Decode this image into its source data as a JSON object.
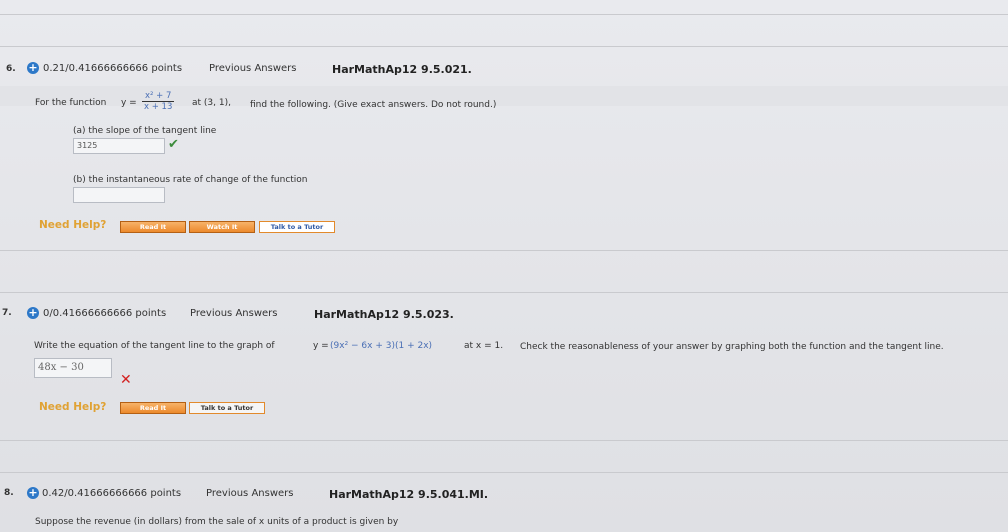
{
  "q6": {
    "number": "6.",
    "points": "0.21/0.41666666666 points",
    "previous": "Previous Answers",
    "code": "HarMathAp12 9.5.021.",
    "prompt_prefix": "For the function",
    "y_eq": "y =",
    "frac_num": "x² + 7",
    "frac_den": "x + 13",
    "point": "at (3, 1),",
    "prompt_suffix": "find the following. (Give exact answers. Do not round.)",
    "part_a": "(a) the slope of the tangent line",
    "answer_a": "3125",
    "part_b": "(b) the instantaneous rate of change of the function",
    "answer_b": "",
    "need_help": "Need Help?",
    "btn_read": "Read It",
    "btn_watch": "Watch It",
    "btn_tutor": "Talk to a Tutor"
  },
  "q7": {
    "number": "7.",
    "points": "0/0.41666666666 points",
    "previous": "Previous Answers",
    "code": "HarMathAp12 9.5.023.",
    "prompt": "Write the equation of the tangent line to the graph of",
    "y_eq": "y = ",
    "expr": "(9x² − 6x + 3)(1 + 2x)",
    "at": "at x = 1.",
    "prompt_suffix": "Check the reasonableness of your answer by graphing both the function and the tangent line.",
    "answer": "48x − 30",
    "need_help": "Need Help?",
    "btn_read": "Read It",
    "btn_tutor": "Talk to a Tutor"
  },
  "q8": {
    "number": "8.",
    "points": "0.42/0.41666666666 points",
    "previous": "Previous Answers",
    "code": "HarMathAp12 9.5.041.MI.",
    "prompt": "Suppose the revenue (in dollars) from the sale of x units of a product is given by"
  },
  "colors": {
    "accent": "#2d78c8",
    "need_help": "#e0a234",
    "correct": "#3c8c3c",
    "wrong": "#d32020"
  },
  "icons": {
    "plus": "plus-circle-icon",
    "check": "checkmark-icon",
    "cross": "cross-icon"
  }
}
